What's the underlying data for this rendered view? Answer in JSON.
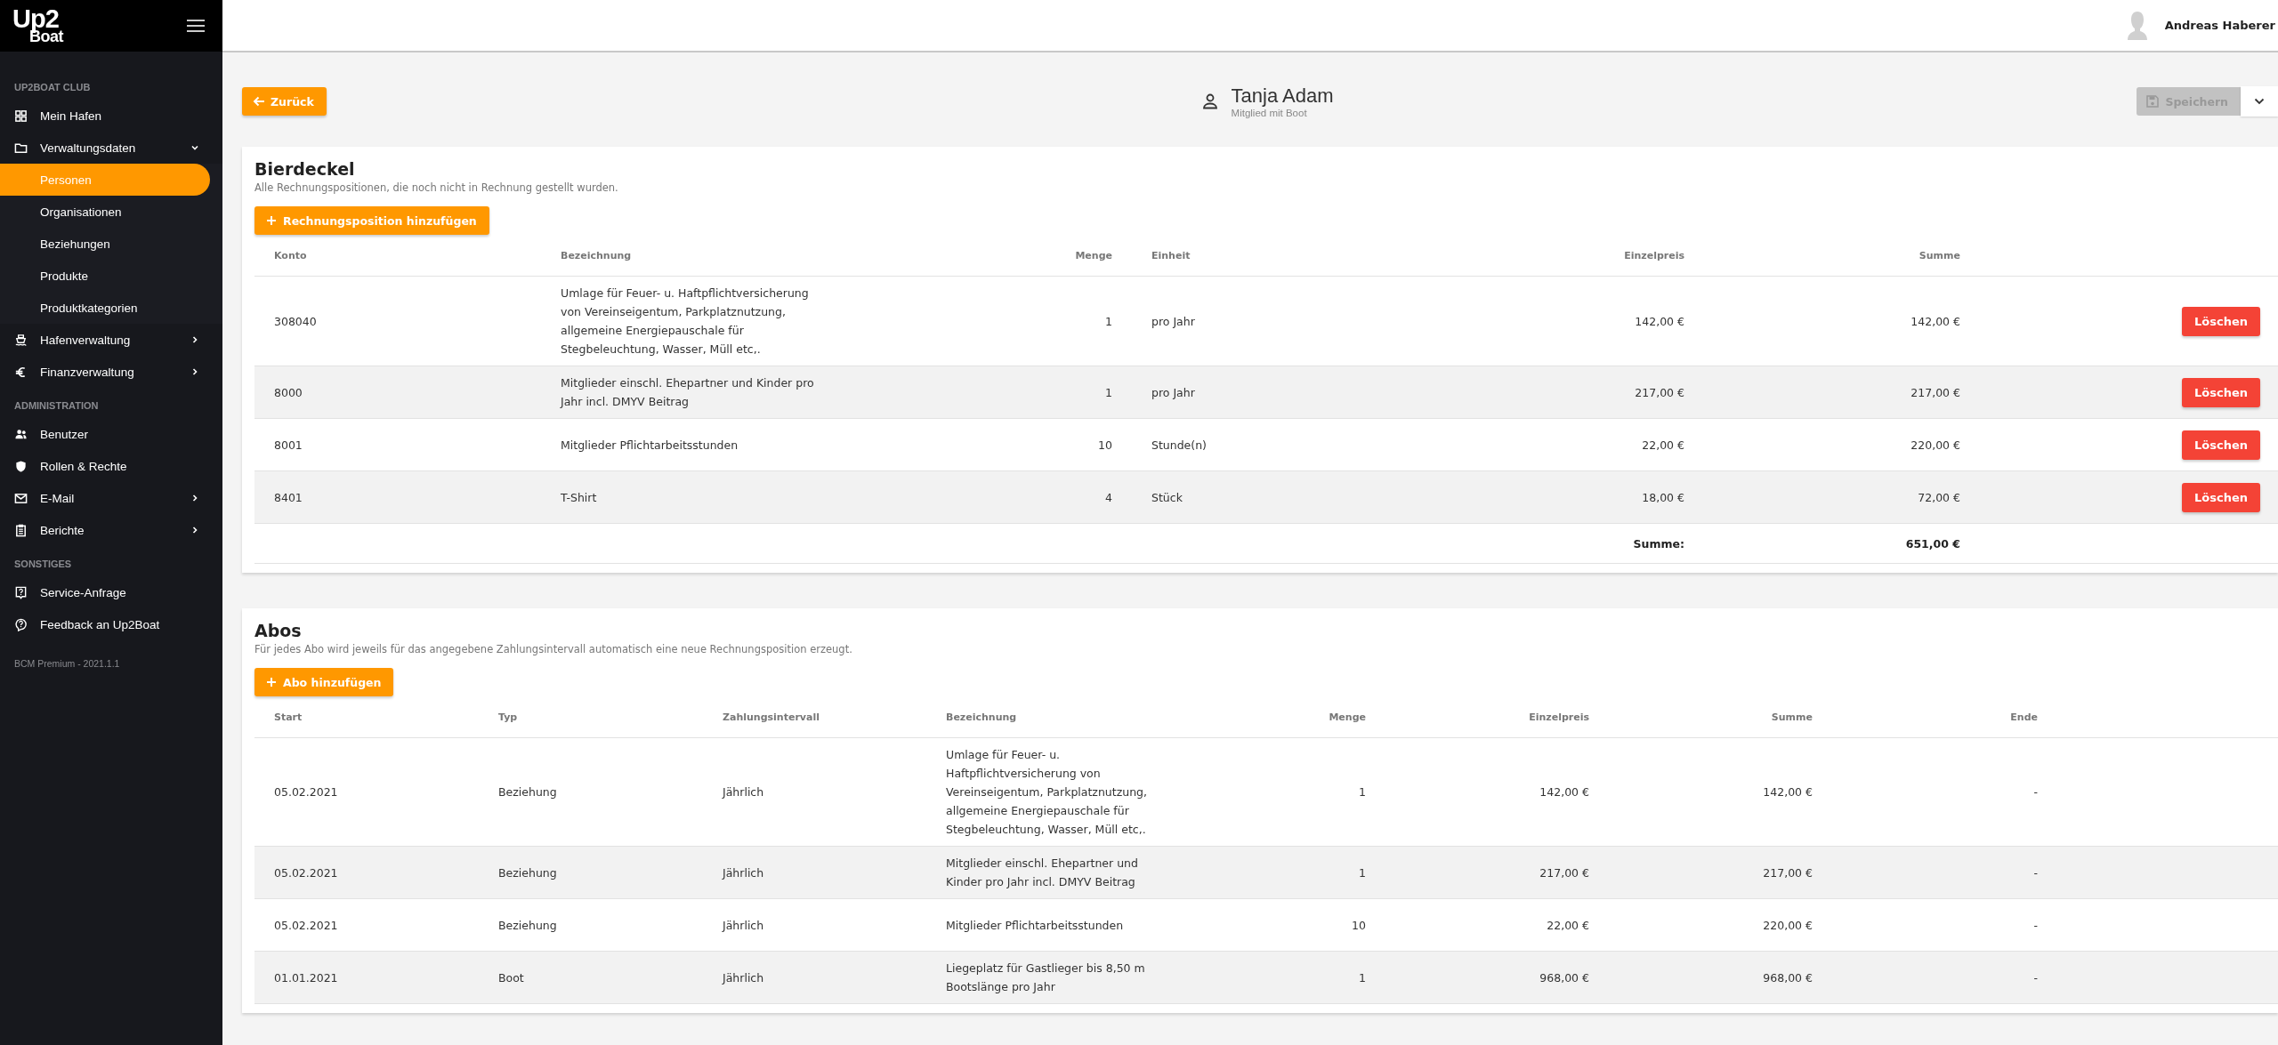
{
  "sidebar": {
    "logo": {
      "top": "Up2",
      "bottom": "Boat"
    },
    "sections": [
      {
        "heading": "UP2BOAT CLUB",
        "items": [
          {
            "label": "Mein Hafen",
            "kind": "link"
          },
          {
            "label": "Verwaltungsdaten",
            "kind": "group",
            "expanded": true,
            "children": [
              {
                "label": "Personen",
                "selected": true
              },
              {
                "label": "Organisationen",
                "selected": false
              },
              {
                "label": "Beziehungen",
                "selected": false
              },
              {
                "label": "Produkte",
                "selected": false
              },
              {
                "label": "Produktkategorien",
                "selected": false
              }
            ]
          },
          {
            "label": "Hafenverwaltung",
            "kind": "group",
            "expanded": false
          },
          {
            "label": "Finanzverwaltung",
            "kind": "group",
            "expanded": false
          }
        ]
      },
      {
        "heading": "ADMINISTRATION",
        "items": [
          {
            "label": "Benutzer",
            "kind": "link"
          },
          {
            "label": "Rollen & Rechte",
            "kind": "link"
          },
          {
            "label": "E-Mail",
            "kind": "group",
            "expanded": false
          },
          {
            "label": "Berichte",
            "kind": "group",
            "expanded": false
          }
        ]
      },
      {
        "heading": "SONSTIGES",
        "items": [
          {
            "label": "Service-Anfrage",
            "kind": "link"
          },
          {
            "label": "Feedback an Up2Boat",
            "kind": "link"
          }
        ]
      }
    ],
    "version": "BCM Premium - 2021.1.1"
  },
  "topbar": {
    "user_name": "Andreas Haberer"
  },
  "page_header": {
    "back_button": "Zurück",
    "person_name": "Tanja Adam",
    "person_role": "Mitglied mit Boot",
    "save_button": {
      "label": "Speichern",
      "disabled": true
    }
  },
  "bierdeckel": {
    "title": "Bierdeckel",
    "description": "Alle Rechnungspositionen, die noch nicht in Rechnung gestellt wurden.",
    "add_button": "Rechnungsposition hinzufügen",
    "columns": [
      "Konto",
      "Bezeichnung",
      "Menge",
      "Einheit",
      "Einzelpreis",
      "Summe"
    ],
    "rows": [
      {
        "konto": "308040",
        "bezeichnung": "Umlage für Feuer- u. Haftpflichtversicherung von Vereinseigentum, Parkplatznutzung, allgemeine Energiepauschale für Stegbeleuchtung, Wasser, Müll etc,.",
        "menge": "1",
        "einheit": "pro Jahr",
        "einzelpreis": "142,00 €",
        "summe": "142,00 €",
        "action": "Löschen"
      },
      {
        "konto": "8000",
        "bezeichnung": "Mitglieder einschl. Ehepartner und Kinder pro Jahr incl. DMYV Beitrag",
        "menge": "1",
        "einheit": "pro Jahr",
        "einzelpreis": "217,00 €",
        "summe": "217,00 €",
        "action": "Löschen"
      },
      {
        "konto": "8001",
        "bezeichnung": "Mitglieder Pflichtarbeitsstunden",
        "menge": "10",
        "einheit": "Stunde(n)",
        "einzelpreis": "22,00 €",
        "summe": "220,00 €",
        "action": "Löschen"
      },
      {
        "konto": "8401",
        "bezeichnung": "T-Shirt",
        "menge": "4",
        "einheit": "Stück",
        "einzelpreis": "18,00 €",
        "summe": "72,00 €",
        "action": "Löschen"
      }
    ],
    "total": {
      "label": "Summe:",
      "value": "651,00 €"
    }
  },
  "abos": {
    "title": "Abos",
    "description": "Für jedes Abo wird jeweils für das angegebene Zahlungsintervall automatisch eine neue Rechnungsposition erzeugt.",
    "add_button": "Abo hinzufügen",
    "columns": [
      "Start",
      "Typ",
      "Zahlungsintervall",
      "Bezeichnung",
      "Menge",
      "Einzelpreis",
      "Summe",
      "Ende"
    ],
    "rows": [
      {
        "start": "05.02.2021",
        "typ": "Beziehung",
        "intervall": "Jährlich",
        "bezeichnung": "Umlage für Feuer- u. Haftpflichtversicherung von Vereinseigentum, Parkplatznutzung, allgemeine Energiepauschale für Stegbeleuchtung, Wasser, Müll etc,.",
        "menge": "1",
        "einzelpreis": "142,00 €",
        "summe": "142,00 €",
        "ende": "-"
      },
      {
        "start": "05.02.2021",
        "typ": "Beziehung",
        "intervall": "Jährlich",
        "bezeichnung": "Mitglieder einschl. Ehepartner und Kinder pro Jahr incl. DMYV Beitrag",
        "menge": "1",
        "einzelpreis": "217,00 €",
        "summe": "217,00 €",
        "ende": "-"
      },
      {
        "start": "05.02.2021",
        "typ": "Beziehung",
        "intervall": "Jährlich",
        "bezeichnung": "Mitglieder Pflichtarbeitsstunden",
        "menge": "10",
        "einzelpreis": "22,00 €",
        "summe": "220,00 €",
        "ende": "-"
      },
      {
        "start": "01.01.2021",
        "typ": "Boot",
        "intervall": "Jährlich",
        "bezeichnung": "Liegeplatz für Gastlieger bis 8,50 m Bootslänge pro Jahr",
        "menge": "1",
        "einzelpreis": "968,00 €",
        "summe": "968,00 €",
        "ende": "-"
      }
    ]
  }
}
